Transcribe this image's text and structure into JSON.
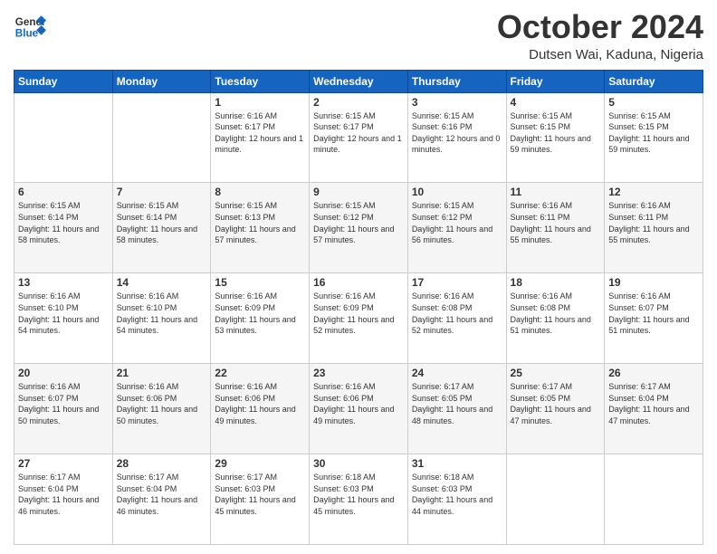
{
  "header": {
    "logo_general": "General",
    "logo_blue": "Blue",
    "month_title": "October 2024",
    "location": "Dutsen Wai, Kaduna, Nigeria"
  },
  "days_of_week": [
    "Sunday",
    "Monday",
    "Tuesday",
    "Wednesday",
    "Thursday",
    "Friday",
    "Saturday"
  ],
  "weeks": [
    [
      {
        "day": "",
        "detail": ""
      },
      {
        "day": "",
        "detail": ""
      },
      {
        "day": "1",
        "detail": "Sunrise: 6:16 AM\nSunset: 6:17 PM\nDaylight: 12 hours\nand 1 minute."
      },
      {
        "day": "2",
        "detail": "Sunrise: 6:15 AM\nSunset: 6:17 PM\nDaylight: 12 hours\nand 1 minute."
      },
      {
        "day": "3",
        "detail": "Sunrise: 6:15 AM\nSunset: 6:16 PM\nDaylight: 12 hours\nand 0 minutes."
      },
      {
        "day": "4",
        "detail": "Sunrise: 6:15 AM\nSunset: 6:15 PM\nDaylight: 11 hours\nand 59 minutes."
      },
      {
        "day": "5",
        "detail": "Sunrise: 6:15 AM\nSunset: 6:15 PM\nDaylight: 11 hours\nand 59 minutes."
      }
    ],
    [
      {
        "day": "6",
        "detail": "Sunrise: 6:15 AM\nSunset: 6:14 PM\nDaylight: 11 hours\nand 58 minutes."
      },
      {
        "day": "7",
        "detail": "Sunrise: 6:15 AM\nSunset: 6:14 PM\nDaylight: 11 hours\nand 58 minutes."
      },
      {
        "day": "8",
        "detail": "Sunrise: 6:15 AM\nSunset: 6:13 PM\nDaylight: 11 hours\nand 57 minutes."
      },
      {
        "day": "9",
        "detail": "Sunrise: 6:15 AM\nSunset: 6:12 PM\nDaylight: 11 hours\nand 57 minutes."
      },
      {
        "day": "10",
        "detail": "Sunrise: 6:15 AM\nSunset: 6:12 PM\nDaylight: 11 hours\nand 56 minutes."
      },
      {
        "day": "11",
        "detail": "Sunrise: 6:16 AM\nSunset: 6:11 PM\nDaylight: 11 hours\nand 55 minutes."
      },
      {
        "day": "12",
        "detail": "Sunrise: 6:16 AM\nSunset: 6:11 PM\nDaylight: 11 hours\nand 55 minutes."
      }
    ],
    [
      {
        "day": "13",
        "detail": "Sunrise: 6:16 AM\nSunset: 6:10 PM\nDaylight: 11 hours\nand 54 minutes."
      },
      {
        "day": "14",
        "detail": "Sunrise: 6:16 AM\nSunset: 6:10 PM\nDaylight: 11 hours\nand 54 minutes."
      },
      {
        "day": "15",
        "detail": "Sunrise: 6:16 AM\nSunset: 6:09 PM\nDaylight: 11 hours\nand 53 minutes."
      },
      {
        "day": "16",
        "detail": "Sunrise: 6:16 AM\nSunset: 6:09 PM\nDaylight: 11 hours\nand 52 minutes."
      },
      {
        "day": "17",
        "detail": "Sunrise: 6:16 AM\nSunset: 6:08 PM\nDaylight: 11 hours\nand 52 minutes."
      },
      {
        "day": "18",
        "detail": "Sunrise: 6:16 AM\nSunset: 6:08 PM\nDaylight: 11 hours\nand 51 minutes."
      },
      {
        "day": "19",
        "detail": "Sunrise: 6:16 AM\nSunset: 6:07 PM\nDaylight: 11 hours\nand 51 minutes."
      }
    ],
    [
      {
        "day": "20",
        "detail": "Sunrise: 6:16 AM\nSunset: 6:07 PM\nDaylight: 11 hours\nand 50 minutes."
      },
      {
        "day": "21",
        "detail": "Sunrise: 6:16 AM\nSunset: 6:06 PM\nDaylight: 11 hours\nand 50 minutes."
      },
      {
        "day": "22",
        "detail": "Sunrise: 6:16 AM\nSunset: 6:06 PM\nDaylight: 11 hours\nand 49 minutes."
      },
      {
        "day": "23",
        "detail": "Sunrise: 6:16 AM\nSunset: 6:06 PM\nDaylight: 11 hours\nand 49 minutes."
      },
      {
        "day": "24",
        "detail": "Sunrise: 6:17 AM\nSunset: 6:05 PM\nDaylight: 11 hours\nand 48 minutes."
      },
      {
        "day": "25",
        "detail": "Sunrise: 6:17 AM\nSunset: 6:05 PM\nDaylight: 11 hours\nand 47 minutes."
      },
      {
        "day": "26",
        "detail": "Sunrise: 6:17 AM\nSunset: 6:04 PM\nDaylight: 11 hours\nand 47 minutes."
      }
    ],
    [
      {
        "day": "27",
        "detail": "Sunrise: 6:17 AM\nSunset: 6:04 PM\nDaylight: 11 hours\nand 46 minutes."
      },
      {
        "day": "28",
        "detail": "Sunrise: 6:17 AM\nSunset: 6:04 PM\nDaylight: 11 hours\nand 46 minutes."
      },
      {
        "day": "29",
        "detail": "Sunrise: 6:17 AM\nSunset: 6:03 PM\nDaylight: 11 hours\nand 45 minutes."
      },
      {
        "day": "30",
        "detail": "Sunrise: 6:18 AM\nSunset: 6:03 PM\nDaylight: 11 hours\nand 45 minutes."
      },
      {
        "day": "31",
        "detail": "Sunrise: 6:18 AM\nSunset: 6:03 PM\nDaylight: 11 hours\nand 44 minutes."
      },
      {
        "day": "",
        "detail": ""
      },
      {
        "day": "",
        "detail": ""
      }
    ]
  ]
}
